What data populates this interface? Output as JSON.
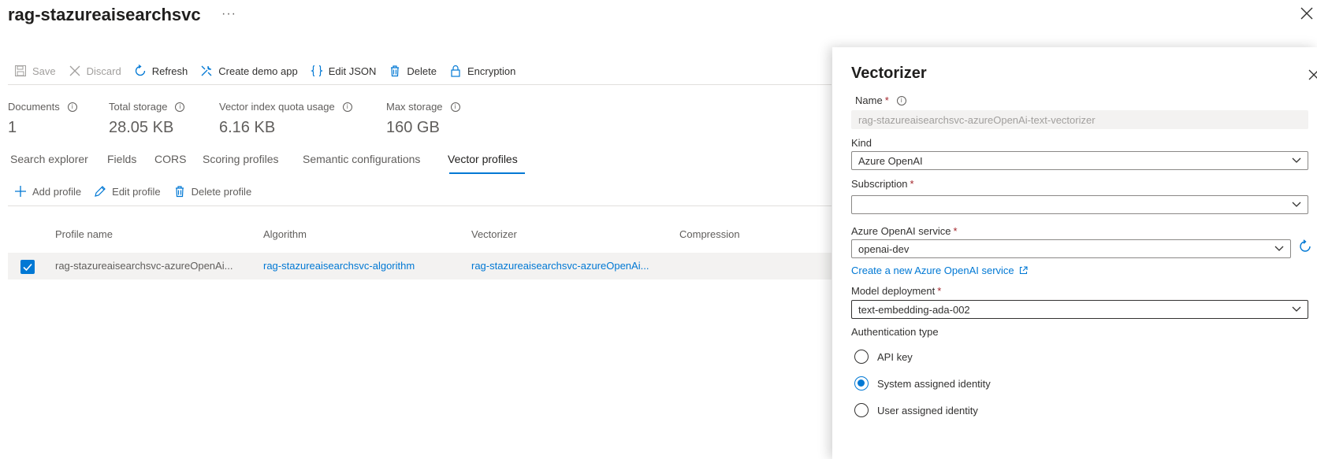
{
  "page": {
    "title": "rag-stazureaisearchsvc",
    "more": "···"
  },
  "toolbar": {
    "save": "Save",
    "discard": "Discard",
    "refresh": "Refresh",
    "create_demo_app": "Create demo app",
    "edit_json": "Edit JSON",
    "delete": "Delete",
    "encryption": "Encryption"
  },
  "stats": [
    {
      "label": "Documents",
      "value": "1"
    },
    {
      "label": "Total storage",
      "value": "28.05 KB"
    },
    {
      "label": "Vector index quota usage",
      "value": "6.16 KB"
    },
    {
      "label": "Max storage",
      "value": "160 GB"
    }
  ],
  "tabs": [
    "Search explorer",
    "Fields",
    "CORS",
    "Scoring profiles",
    "Semantic configurations",
    "Vector profiles"
  ],
  "active_tab": "Vector profiles",
  "subtoolbar": {
    "add": "Add profile",
    "edit": "Edit profile",
    "delete": "Delete profile"
  },
  "table": {
    "headers": [
      "Profile name",
      "Algorithm",
      "Vectorizer",
      "Compression"
    ],
    "rows": [
      {
        "profile_name": "rag-stazureaisearchsvc-azureOpenAi...",
        "algorithm": "rag-stazureaisearchsvc-algorithm",
        "vectorizer": "rag-stazureaisearchsvc-azureOpenAi...",
        "compression": "",
        "selected": true
      }
    ]
  },
  "panel": {
    "title": "Vectorizer",
    "name_label": "Name",
    "name_value": "rag-stazureaisearchsvc-azureOpenAi-text-vectorizer",
    "kind_label": "Kind",
    "kind_value": "Azure OpenAI",
    "subscription_label": "Subscription",
    "subscription_value": "",
    "service_label": "Azure OpenAI service",
    "service_value": "openai-dev",
    "create_link": "Create a new Azure OpenAI service",
    "deployment_label": "Model deployment",
    "deployment_value": "text-embedding-ada-002",
    "auth_label": "Authentication type",
    "auth_options": [
      "API key",
      "System assigned identity",
      "User assigned identity"
    ],
    "auth_selected": "System assigned identity"
  },
  "colors": {
    "accent": "#0078d4",
    "required": "#a4262c",
    "text": "#323130",
    "muted": "#605e5c"
  }
}
